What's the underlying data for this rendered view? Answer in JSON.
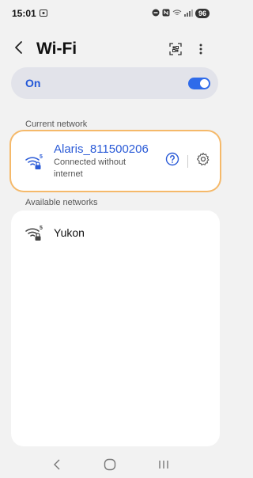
{
  "status_bar": {
    "time": "15:01",
    "battery": "96"
  },
  "header": {
    "title": "Wi-Fi"
  },
  "wifi_toggle": {
    "label": "On",
    "enabled": true
  },
  "current_network": {
    "section_label": "Current network",
    "name": "Alaris_811500206",
    "status_line1": "Connected without",
    "status_line2": "internet",
    "signal_badge": "5"
  },
  "available_networks": {
    "section_label": "Available networks",
    "items": [
      {
        "name": "Yukon",
        "signal_badge": "5"
      }
    ]
  },
  "colors": {
    "accent": "#2b5bd7",
    "toggle": "#2f6bea",
    "highlight": "#f5b96a"
  },
  "icons": [
    "screenshot-icon",
    "dnd-icon",
    "nfc-icon",
    "wifi-status-icon",
    "signal-icon",
    "battery-icon",
    "back-icon",
    "qr-scan-icon",
    "more-options-icon",
    "wifi-lock-icon",
    "help-icon",
    "gear-icon",
    "nav-back-icon",
    "nav-home-icon",
    "nav-recents-icon"
  ]
}
